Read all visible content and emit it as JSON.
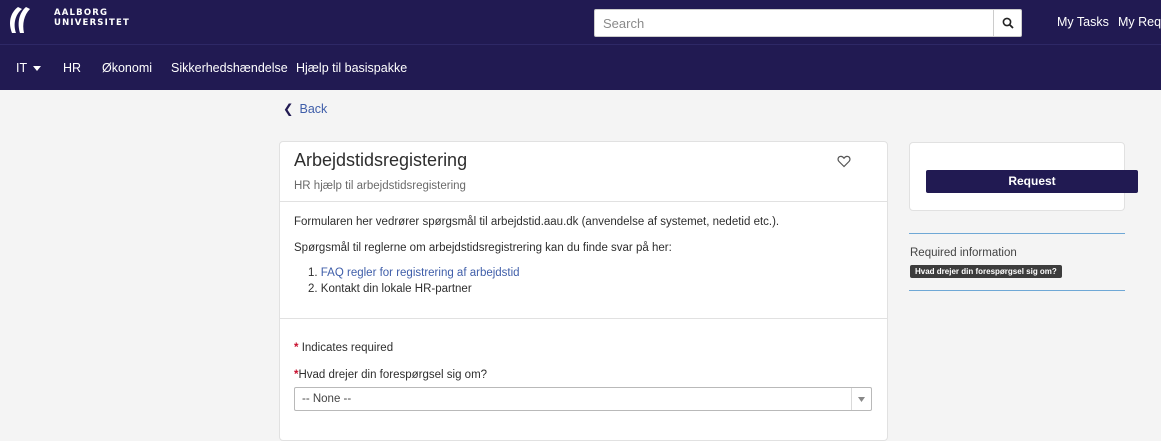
{
  "header": {
    "logo_line1": "AALBORG",
    "logo_line2": "UNIVERSITET",
    "search_placeholder": "Search",
    "links": [
      "My Tasks",
      "My Requ"
    ],
    "icons": [
      "aau-logo",
      "search-icon"
    ]
  },
  "nav": {
    "items": [
      "IT",
      "HR",
      "Økonomi",
      "Sikkerhedshændelse",
      "Hjælp til basispakke"
    ]
  },
  "back_label": "Back",
  "item": {
    "title": "Arbejdstidsregistering",
    "subtitle": "HR hjælp til arbejdstidsregistering",
    "description_1": "Formularen her vedrører spørgsmål til arbejdstid.aau.dk (anvendelse af systemet, nedetid etc.).",
    "description_2": "Spørgsmål til reglerne om arbejdstidsregistrering kan du finde svar på her:",
    "list": [
      {
        "number": "1.",
        "text": "FAQ regler for registrering af arbejdstid"
      },
      {
        "number": "2.",
        "text": "Kontakt din lokale HR-partner"
      }
    ],
    "required_marker": "*",
    "required_note": "Indicates required",
    "question_label": "Hvad drejer din forespørgsel sig om?",
    "select_value": "-- None --"
  },
  "side": {
    "request_button": "Request",
    "required_info_label": "Required information",
    "required_tag": "Hvad drejer din forespørgsel sig om?"
  },
  "colors": {
    "brand": "#211a52",
    "link": "#3f5ea9",
    "required": "#c8102e",
    "info_rule": "#6fa8d6"
  }
}
